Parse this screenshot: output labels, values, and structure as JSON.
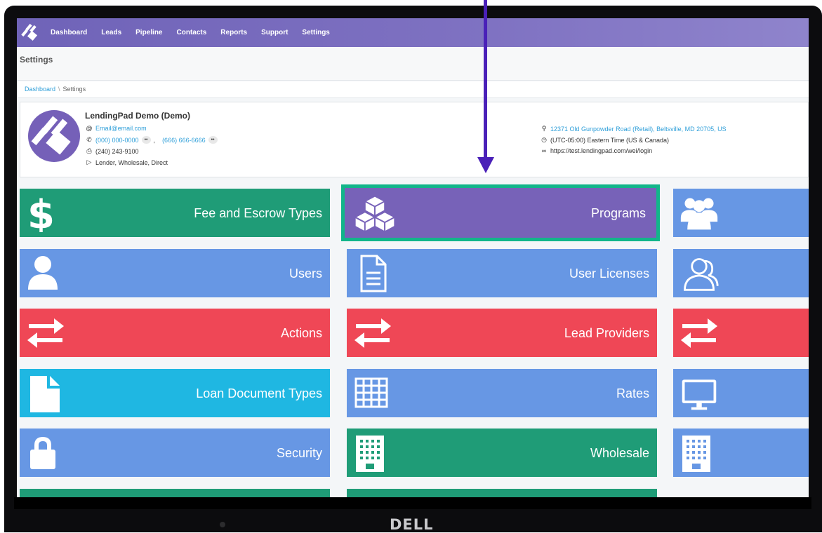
{
  "nav": {
    "items": [
      "Dashboard",
      "Leads",
      "Pipeline",
      "Contacts",
      "Reports",
      "Support",
      "Settings"
    ]
  },
  "page": {
    "title": "Settings"
  },
  "breadcrumb": {
    "home": "Dashboard",
    "separator": "\\",
    "current": "Settings"
  },
  "profile": {
    "name": "LendingPad Demo (Demo)",
    "email": "Email@email.com",
    "phone1": "(000) 000-0000",
    "phone_sep": ",",
    "phone2": "(666) 666-6666",
    "fax": "(240) 243-9100",
    "tags": "Lender, Wholesale, Direct",
    "address": "12371 Old Gunpowder Road (Retail), Beltsville, MD 20705, US",
    "timezone": "(UTC-05:00) Eastern Time (US & Canada)",
    "url": "https://test.lendingpad.com/wei/login"
  },
  "tiles": {
    "fee_escrow": "Fee and Escrow Types",
    "programs": "Programs",
    "users": "Users",
    "user_licenses": "User Licenses",
    "actions": "Actions",
    "lead_providers": "Lead Providers",
    "loan_doc_types": "Loan Document Types",
    "rates": "Rates",
    "security": "Security",
    "wholesale": "Wholesale"
  },
  "device": {
    "brand": "DELL"
  },
  "colors": {
    "nav": "#7f72c2",
    "green": "#1f9c77",
    "blue": "#6797e4",
    "red": "#ef4756",
    "cyan": "#1fb7e2",
    "purple": "#7762b8",
    "highlight_border": "#12b58a",
    "annotation_arrow": "#4a20b8"
  }
}
